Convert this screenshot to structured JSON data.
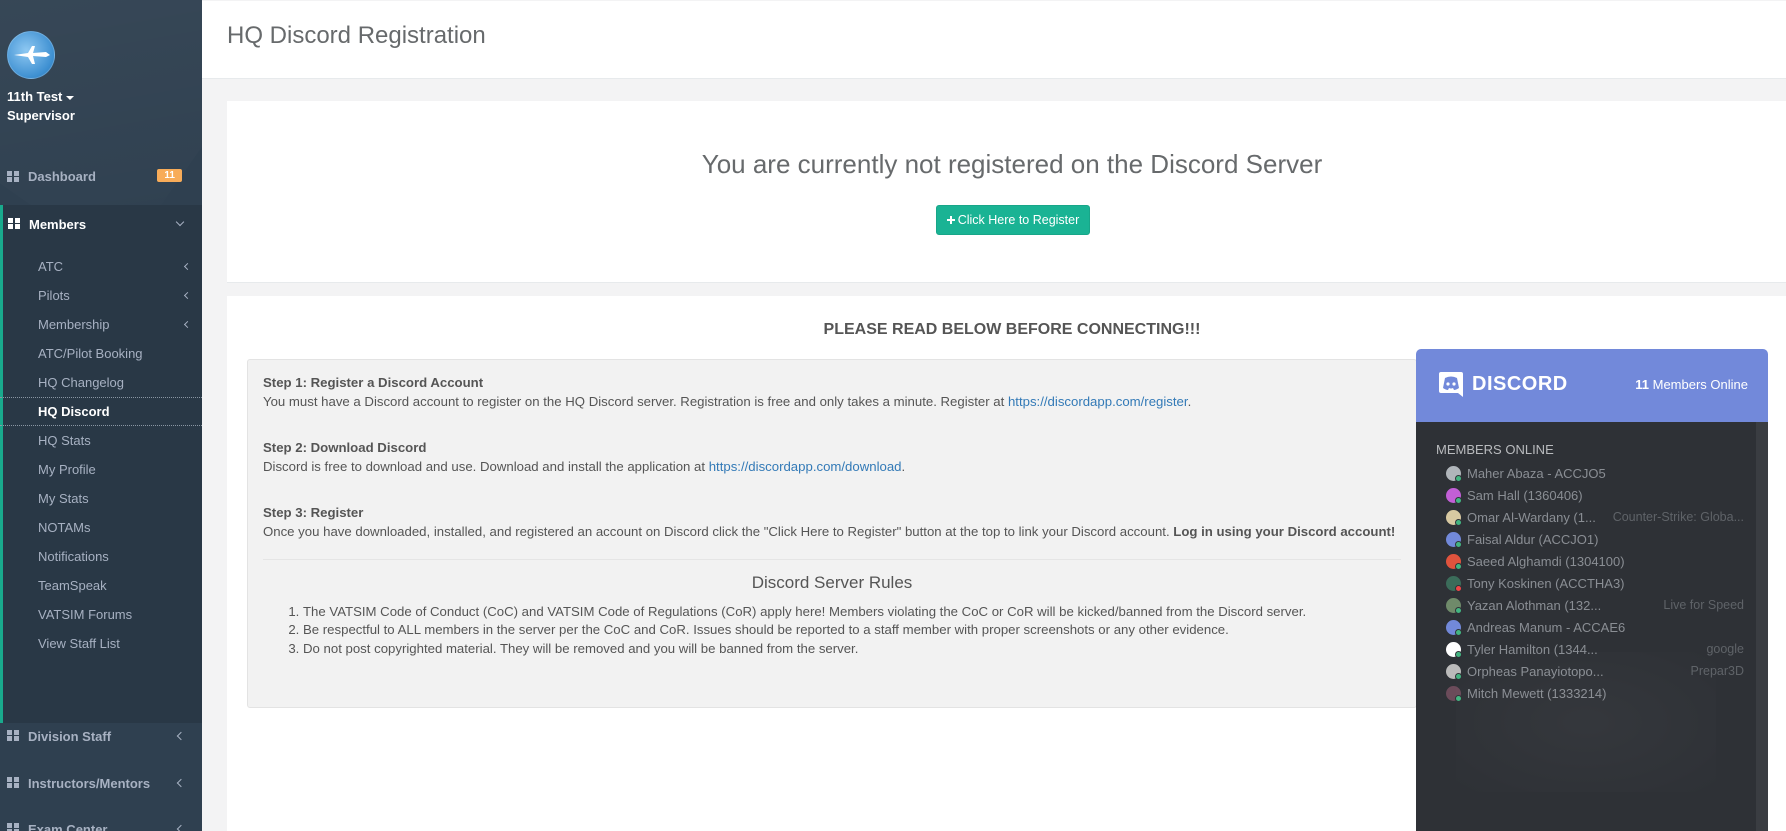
{
  "sidebar": {
    "profile": {
      "name": "11th Test",
      "role": "Supervisor"
    },
    "dashboard": {
      "label": "Dashboard",
      "badge": "11"
    },
    "members": {
      "label": "Members",
      "items": [
        {
          "label": "ATC",
          "has_submenu": true
        },
        {
          "label": "Pilots",
          "has_submenu": true
        },
        {
          "label": "Membership",
          "has_submenu": true
        },
        {
          "label": "ATC/Pilot Booking"
        },
        {
          "label": "HQ Changelog"
        },
        {
          "label": "HQ Discord",
          "active": true
        },
        {
          "label": "HQ Stats"
        },
        {
          "label": "My Profile"
        },
        {
          "label": "My Stats"
        },
        {
          "label": "NOTAMs"
        },
        {
          "label": "Notifications"
        },
        {
          "label": "TeamSpeak"
        },
        {
          "label": "VATSIM Forums"
        },
        {
          "label": "View Staff List"
        }
      ]
    },
    "division_staff": "Division Staff",
    "instructors": "Instructors/Mentors",
    "exam_center": "Exam Center"
  },
  "header": {
    "title": "HQ Discord Registration"
  },
  "status_panel": {
    "message": "You are currently not registered on the Discord Server",
    "register_button": "Click Here to Register"
  },
  "instructions": {
    "title": "PLEASE READ BELOW BEFORE CONNECTING!!!",
    "step1": {
      "title": "Step 1: Register a Discord Account",
      "text": "You must have a Discord account to register on the HQ Discord server. Registration is free and only takes a minute. Register at ",
      "link": "https://discordapp.com/register"
    },
    "step2": {
      "title": "Step 2: Download Discord",
      "text": "Discord is free to download and use. Download and install the application at ",
      "link": "https://discordapp.com/download"
    },
    "step3": {
      "title": "Step 3: Register",
      "text": "Once you have downloaded, installed, and registered an account on Discord click the \"Click Here to Register\" button at the top to link your Discord account. ",
      "bold": "Log in using your Discord account!"
    },
    "rules_title": "Discord Server Rules",
    "rules": [
      "The VATSIM Code of Conduct (CoC) and VATSIM Code of Regulations (CoR) apply here! Members violating the CoC or CoR will be kicked/banned from the Discord server.",
      "Be respectful to ALL members in the server per the CoC and CoR. Issues should be reported to a staff member with proper screenshots or any other evidence.",
      "Do not post copyrighted material. They will be removed and you will be banned from the server."
    ]
  },
  "discord_widget": {
    "brand": "DISCORD",
    "online_count": "11",
    "online_label": "Members Online",
    "members_title": "MEMBERS ONLINE",
    "members": [
      {
        "name": "Maher Abaza - ACCJO5",
        "game": "",
        "color": "#b0b5ba",
        "status": "online"
      },
      {
        "name": "Sam Hall (1360406)",
        "game": "",
        "color": "#c25fd6",
        "status": "online"
      },
      {
        "name": "Omar Al-Wardany (1...",
        "game": "Counter-Strike: Globa...",
        "color": "#d8c9a2",
        "status": "online"
      },
      {
        "name": "Faisal Aldur (ACCJO1)",
        "game": "",
        "color": "#7289da",
        "status": "online"
      },
      {
        "name": "Saeed Alghamdi (1304100)",
        "game": "",
        "color": "#e0533d",
        "status": "online"
      },
      {
        "name": "Tony Koskinen (ACCTHA3)",
        "game": "",
        "color": "#3b6c5a",
        "status": "dnd"
      },
      {
        "name": "Yazan Alothman (132...",
        "game": "Live for Speed",
        "color": "#6f8a6a",
        "status": "online"
      },
      {
        "name": "Andreas Manum - ACCAE6",
        "game": "",
        "color": "#7289da",
        "status": "online"
      },
      {
        "name": "Tyler Hamilton (1344...",
        "game": "google",
        "color": "#ffffff",
        "status": "online"
      },
      {
        "name": "Orpheas Panayiotopo...",
        "game": "Prepar3D",
        "color": "#bbbbbb",
        "status": "online"
      },
      {
        "name": "Mitch Mewett (1333214)",
        "game": "",
        "color": "#6b4b5a",
        "status": "online"
      }
    ]
  }
}
